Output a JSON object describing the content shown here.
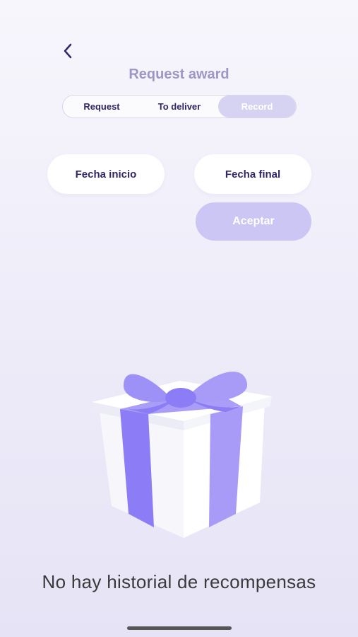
{
  "header": {
    "title": "Request award",
    "back_icon": "chevron-left-icon"
  },
  "tabs": [
    {
      "label": "Request",
      "active": false
    },
    {
      "label": "To deliver",
      "active": false
    },
    {
      "label": "Record",
      "active": true
    }
  ],
  "filters": {
    "start_date_label": "Fecha inicio",
    "end_date_label": "Fecha final",
    "accept_label": "Aceptar"
  },
  "empty_state": {
    "illustration": "gift-box-icon",
    "message": "No hay historial de recompensas"
  },
  "colors": {
    "accent": "#8c7cf5",
    "title": "#9e96c6",
    "text_dark": "#2f2766",
    "accept_bg": "#cbc6f4",
    "active_tab_bg": "#d6d2f1"
  }
}
